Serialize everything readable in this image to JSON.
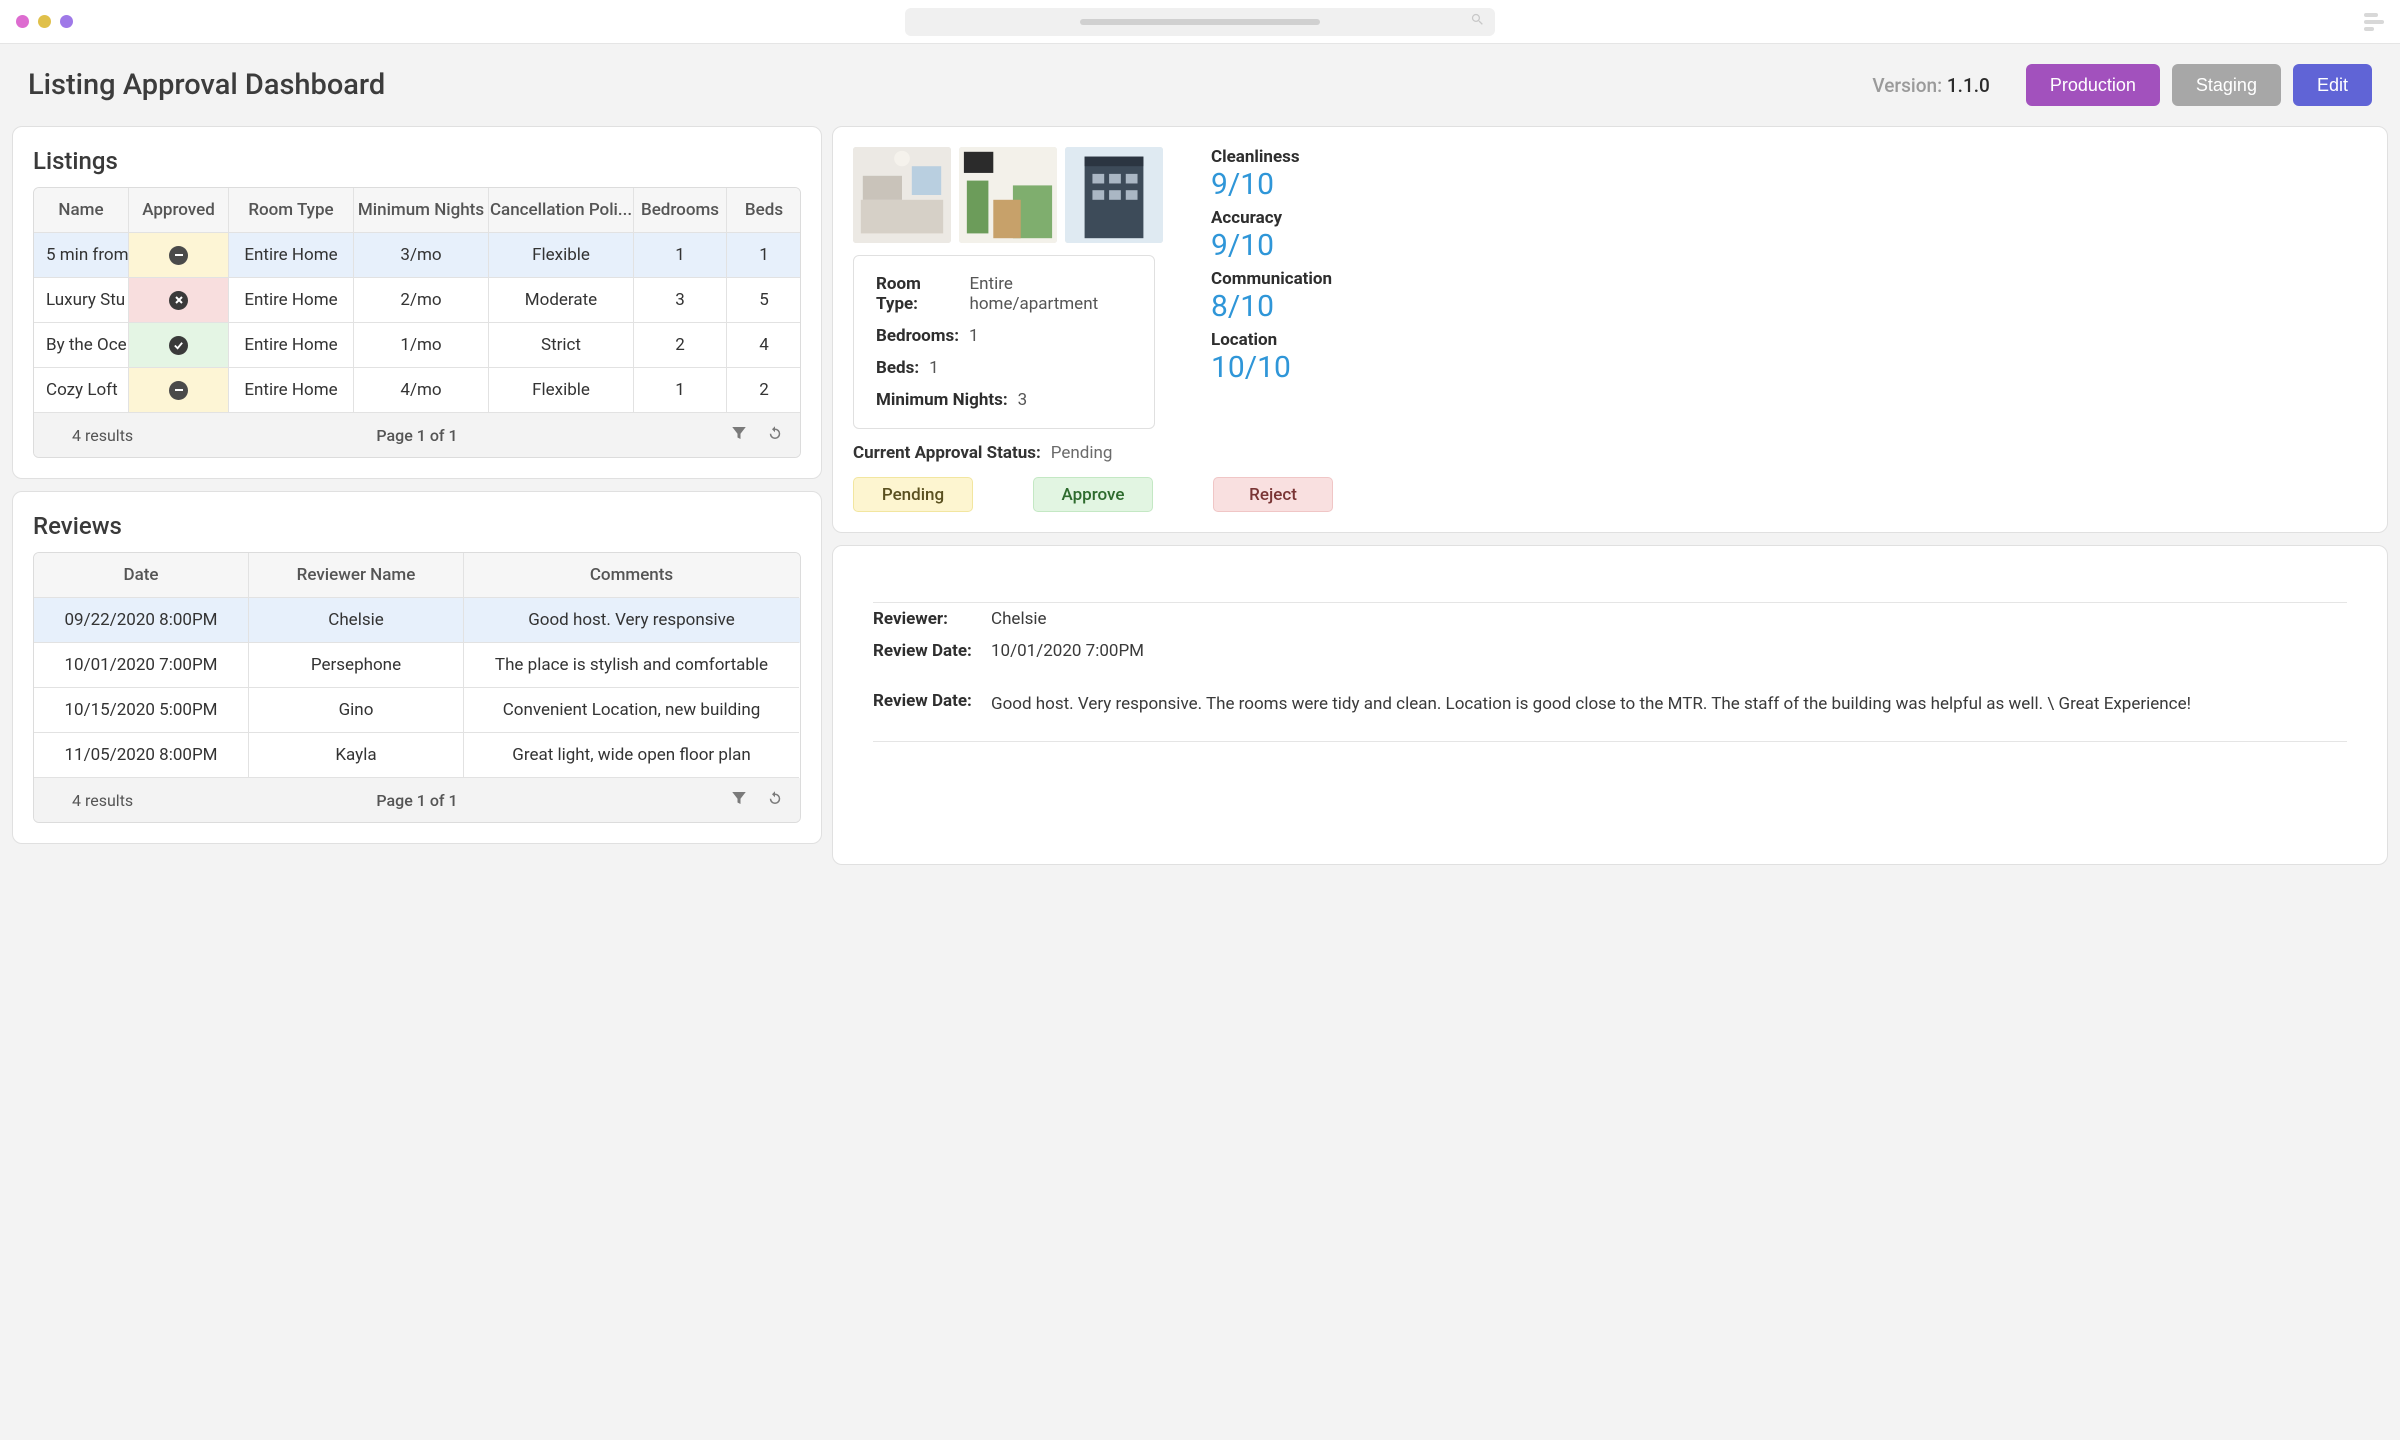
{
  "header": {
    "title": "Listing Approval Dashboard",
    "version_label": "Version:",
    "version_value": "1.1.0",
    "btn_production": "Production",
    "btn_staging": "Staging",
    "btn_edit": "Edit"
  },
  "listings": {
    "title": "Listings",
    "columns": [
      "Name",
      "Approved",
      "Room Type",
      "Minimum Nights",
      "Cancellation Poli...",
      "Bedrooms",
      "Beds"
    ],
    "rows": [
      {
        "name": "5 min from",
        "status": "pending",
        "room_type": "Entire Home",
        "min_nights": "3/mo",
        "cancellation": "Flexible",
        "bedrooms": "1",
        "beds": "1"
      },
      {
        "name": "Luxury Stu",
        "status": "rejected",
        "room_type": "Entire Home",
        "min_nights": "2/mo",
        "cancellation": "Moderate",
        "bedrooms": "3",
        "beds": "5"
      },
      {
        "name": "By the Oce",
        "status": "approved",
        "room_type": "Entire Home",
        "min_nights": "1/mo",
        "cancellation": "Strict",
        "bedrooms": "2",
        "beds": "4"
      },
      {
        "name": "Cozy Loft",
        "status": "pending",
        "room_type": "Entire Home",
        "min_nights": "4/mo",
        "cancellation": "Flexible",
        "bedrooms": "1",
        "beds": "2"
      }
    ],
    "selected": 0,
    "results": "4 results",
    "page": "Page 1 of 1"
  },
  "reviews": {
    "title": "Reviews",
    "columns": [
      "Date",
      "Reviewer Name",
      "Comments"
    ],
    "rows": [
      {
        "date": "09/22/2020 8:00PM",
        "name": "Chelsie",
        "comments": "Good host. Very responsive"
      },
      {
        "date": "10/01/2020 7:00PM",
        "name": "Persephone",
        "comments": "The place is stylish and comfortable"
      },
      {
        "date": "10/15/2020 5:00PM",
        "name": "Gino",
        "comments": "Convenient Location, new building"
      },
      {
        "date": "11/05/2020 8:00PM",
        "name": "Kayla",
        "comments": "Great light, wide open floor plan"
      }
    ],
    "selected": 0,
    "results": "4 results",
    "page": "Page 1 of 1"
  },
  "detail": {
    "room_type_label": "Room Type:",
    "room_type_value": "Entire home/apartment",
    "bedrooms_label": "Bedrooms:",
    "bedrooms_value": "1",
    "beds_label": "Beds:",
    "beds_value": "1",
    "min_nights_label": "Minimum Nights:",
    "min_nights_value": "3",
    "approval_label": "Current Approval Status:",
    "approval_value": "Pending",
    "scores": [
      {
        "label": "Cleanliness",
        "value": "9/10"
      },
      {
        "label": "Accuracy",
        "value": "9/10"
      },
      {
        "label": "Communication",
        "value": "8/10"
      },
      {
        "label": "Location",
        "value": "10/10"
      }
    ],
    "btn_pending": "Pending",
    "btn_approve": "Approve",
    "btn_reject": "Reject"
  },
  "review_detail": {
    "reviewer_label": "Reviewer:",
    "reviewer_value": "Chelsie",
    "date_label": "Review Date:",
    "date_value": "10/01/2020 7:00PM",
    "body_label": "Review Date:",
    "body_value": "Good host. Very responsive. The rooms were tidy and clean. Location is good close to the MTR. The staff of the building was helpful as well. \\ Great Experience!"
  }
}
